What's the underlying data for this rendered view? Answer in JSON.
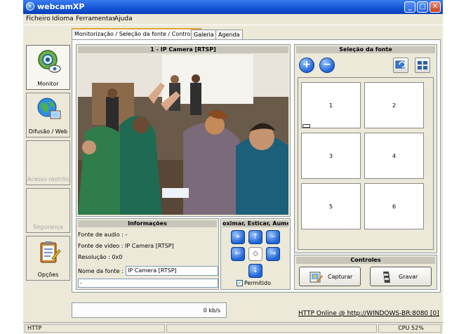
{
  "window": {
    "title": "webcamXP",
    "buttons": {
      "minimize": "_",
      "maximize": "□",
      "close": "✕"
    }
  },
  "menu": [
    "Ficheiro",
    "Idioma",
    "Ferramentas",
    "Ajuda"
  ],
  "sidebar": {
    "items": [
      {
        "label": "Monitor",
        "icon": "webcam-eye-icon",
        "state": "active"
      },
      {
        "label": "Difusão / Web",
        "icon": "globe-monitor-icon",
        "state": "normal"
      },
      {
        "label": "Acesso restrito",
        "icon": "",
        "state": "disabled"
      },
      {
        "label": "Segurança",
        "icon": "",
        "state": "disabled"
      },
      {
        "label": "Opções",
        "icon": "clipboard-icon",
        "state": "normal"
      }
    ]
  },
  "tabs": [
    {
      "label": "Monitorização / Seleção da fonte / Controles",
      "active": true
    },
    {
      "label": "Galeria",
      "active": false
    },
    {
      "label": "Agenda",
      "active": false
    }
  ],
  "video": {
    "title": "1 - IP Camera [RTSP]"
  },
  "source_selection": {
    "title": "Seleção da fonte",
    "add_icon": "plus-icon",
    "remove_icon": "minus-icon",
    "cells": [
      "1",
      "2",
      "3",
      "4",
      "5",
      "6"
    ]
  },
  "info": {
    "title": "Informações",
    "audio_source": "Fonte de audio : -",
    "video_source": "Fonte de video : IP Camera [RTSP]",
    "resolution": "Resolução : 0x0",
    "source_name_label": "Nome da fonte :",
    "source_name_value": "IP Camera [RTSP]",
    "extra_value": "-"
  },
  "zoom": {
    "title": "oximar, Esticar, Aumer",
    "permitted_label": "Permitido",
    "permitted_checked": true,
    "checkmark": "✓",
    "buttons": {
      "zoom_in": "+",
      "up": "↑",
      "zoom_out": "−",
      "left": "←",
      "center": "◇",
      "right": "→",
      "down": "↓"
    }
  },
  "controls": {
    "title": "Controles",
    "capture_label": "Capturar",
    "record_label": "Gravar"
  },
  "bandwidth": "0 kb/s",
  "server_link": "HTTP Online @ http://WINDOWS-BR:8080 [0]",
  "status": {
    "left": "HTTP",
    "middle": "",
    "right": "CPU 52%"
  },
  "colors": {
    "titlebar": "#1454d4",
    "tab_highlight": "#e5a43a",
    "chrome": "#ece9d8"
  }
}
